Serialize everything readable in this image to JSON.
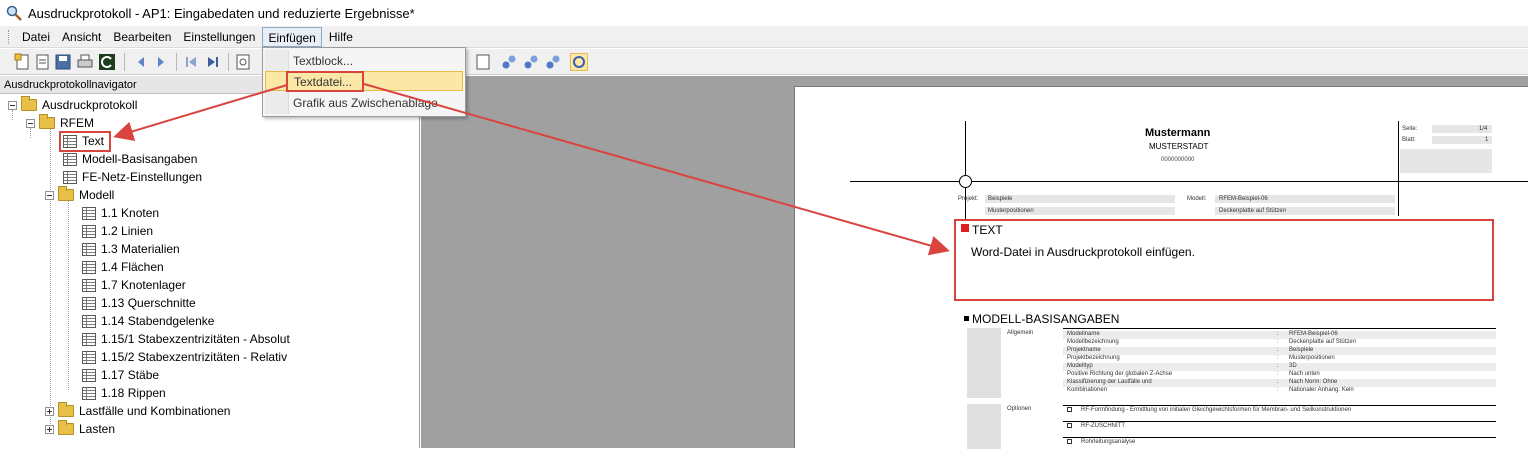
{
  "window": {
    "title": "Ausdruckprotokoll - AP1: Eingabedaten und reduzierte Ergebnisse*"
  },
  "menu": {
    "items": [
      "Datei",
      "Ansicht",
      "Bearbeiten",
      "Einstellungen",
      "Einfügen",
      "Hilfe"
    ],
    "active": "Einfügen"
  },
  "dropdown": {
    "items": [
      "Textblock...",
      "Textdatei...",
      "Grafik aus Zwischenablage"
    ],
    "highlighted": "Textdatei..."
  },
  "navigator": {
    "header": "Ausdruckprotokollnavigator",
    "root": "Ausdruckprotokoll",
    "rfem": "RFEM",
    "text": "Text",
    "modell_basis": "Modell-Basisangaben",
    "fe_netz": "FE-Netz-Einstellungen",
    "modell": "Modell",
    "modell_items": [
      "1.1 Knoten",
      "1.2 Linien",
      "1.3 Materialien",
      "1.4 Flächen",
      "1.7 Knotenlager",
      "1.13 Querschnitte",
      "1.14 Stabendgelenke",
      "1.15/1 Stabexzentrizitäten - Absolut",
      "1.15/2 Stabexzentrizitäten - Relativ",
      "1.17 Stäbe",
      "1.18 Rippen"
    ],
    "lastfaelle": "Lastfälle und Kombinationen",
    "lasten": "Lasten"
  },
  "page": {
    "company": "Mustermann",
    "city": "MUSTERSTADT",
    "zip": "0000000000",
    "seite_label": "Seite:",
    "seite_value": "1/4",
    "blatt_label": "Blatt:",
    "blatt_value": "1",
    "projekt_label": "Projekt:",
    "projekt_value": "Beispiele",
    "projekt_sub": "Musterpositionen",
    "modell_label": "Modell:",
    "modell_value": "RFEM-Beispiel-06",
    "modell_sub": "Deckenplatte auf Stützen",
    "text_heading": "TEXT",
    "text_body": "Word-Datei in Ausdruckprotokoll einfügen.",
    "basis_heading": "MODELL-BASISANGABEN",
    "allgemein_label": "Allgemein",
    "basis_rows": [
      {
        "key": "Modellname",
        "value": "RFEM-Beispiel-06"
      },
      {
        "key": "Modellbezeichnung",
        "value": "Deckenplatte auf Stützen"
      },
      {
        "key": "Projektname",
        "value": "Beispiele"
      },
      {
        "key": "Projektbezeichnung",
        "value": "Musterpositionen"
      },
      {
        "key": "Modelltyp",
        "value": "3D"
      },
      {
        "key": "Positive Richtung der globalen Z-Achse",
        "value": "Nach unten"
      },
      {
        "key": "Klassifizierung der Lastfälle und",
        "value": "Nach Norm: Ohne"
      },
      {
        "key": "Kombinationen",
        "value": "Nationaler Anhang: Kein"
      }
    ],
    "optionen_label": "Optionen",
    "optionen_rows": [
      "RF-Formfindung - Ermittlung von initialen Gleichgewichtsformen für Membran- und Seilkonstruktionen",
      "RF-ZUSCHNITT",
      "Rohrleitungsanalyse"
    ]
  },
  "colors": {
    "accent_red": "#d9443f",
    "menu_hover": "#fbe7a6",
    "workspace": "#a0a0a0"
  }
}
